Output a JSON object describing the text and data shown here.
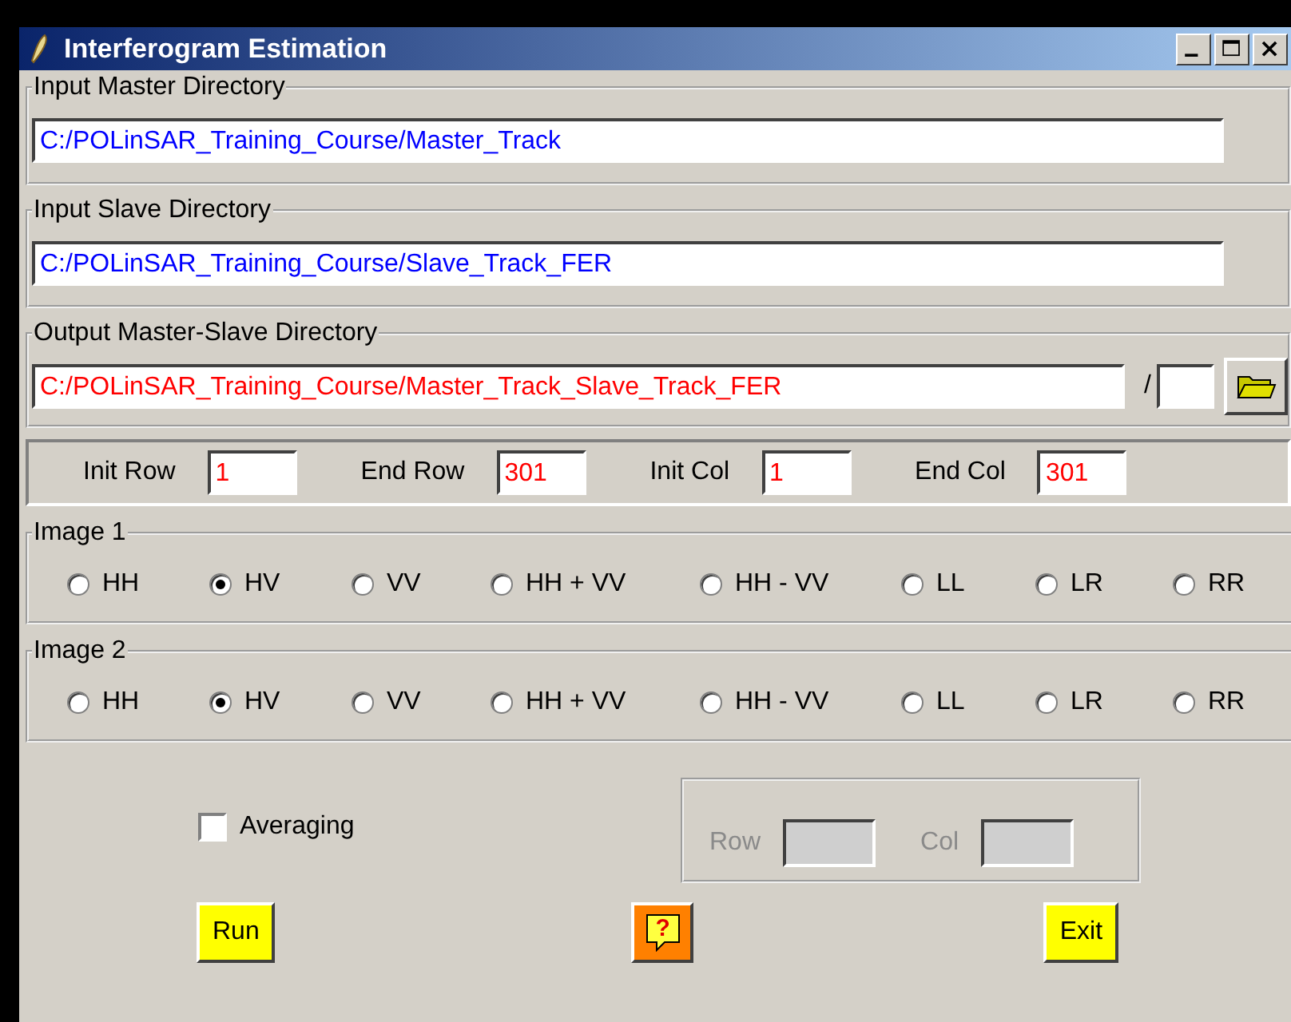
{
  "window": {
    "title": "Interferogram Estimation"
  },
  "directories": [
    {
      "label": "Input Master Directory",
      "value": "C:/POLinSAR_Training_Course/Master_Track",
      "color": "#0000ff",
      "kind": "plain"
    },
    {
      "label": "Input Slave Directory",
      "value": "C:/POLinSAR_Training_Course/Slave_Track_FER",
      "color": "#0000ff",
      "kind": "plain"
    },
    {
      "label": "Output Master-Slave Directory",
      "value": "C:/POLinSAR_Training_Course/Master_Track_Slave_Track_FER",
      "color": "#ff0000",
      "kind": "output",
      "separator": "/"
    }
  ],
  "range": [
    {
      "label": "Init Row",
      "value": "1"
    },
    {
      "label": "End Row",
      "value": "301"
    },
    {
      "label": "Init Col",
      "value": "1"
    },
    {
      "label": "End Col",
      "value": "301"
    }
  ],
  "image_groups": [
    {
      "label": "Image 1",
      "options": [
        {
          "label": "HH",
          "selected": false
        },
        {
          "label": "HV",
          "selected": true
        },
        {
          "label": "VV",
          "selected": false
        },
        {
          "label": "HH + VV",
          "selected": false
        },
        {
          "label": "HH - VV",
          "selected": false
        },
        {
          "label": "LL",
          "selected": false
        },
        {
          "label": "LR",
          "selected": false
        },
        {
          "label": "RR",
          "selected": false
        }
      ]
    },
    {
      "label": "Image 2",
      "options": [
        {
          "label": "HH",
          "selected": false
        },
        {
          "label": "HV",
          "selected": true
        },
        {
          "label": "VV",
          "selected": false
        },
        {
          "label": "HH + VV",
          "selected": false
        },
        {
          "label": "HH - VV",
          "selected": false
        },
        {
          "label": "LL",
          "selected": false
        },
        {
          "label": "LR",
          "selected": false
        },
        {
          "label": "RR",
          "selected": false
        }
      ]
    }
  ],
  "averaging": {
    "label": "Averaging",
    "checked": false,
    "window": {
      "disabled": true,
      "fields": [
        {
          "label": "Row"
        },
        {
          "label": "Col"
        }
      ]
    }
  },
  "buttons": [
    {
      "kind": "text",
      "label": "Run"
    },
    {
      "kind": "help",
      "label": "?"
    },
    {
      "kind": "text",
      "label": "Exit"
    }
  ]
}
